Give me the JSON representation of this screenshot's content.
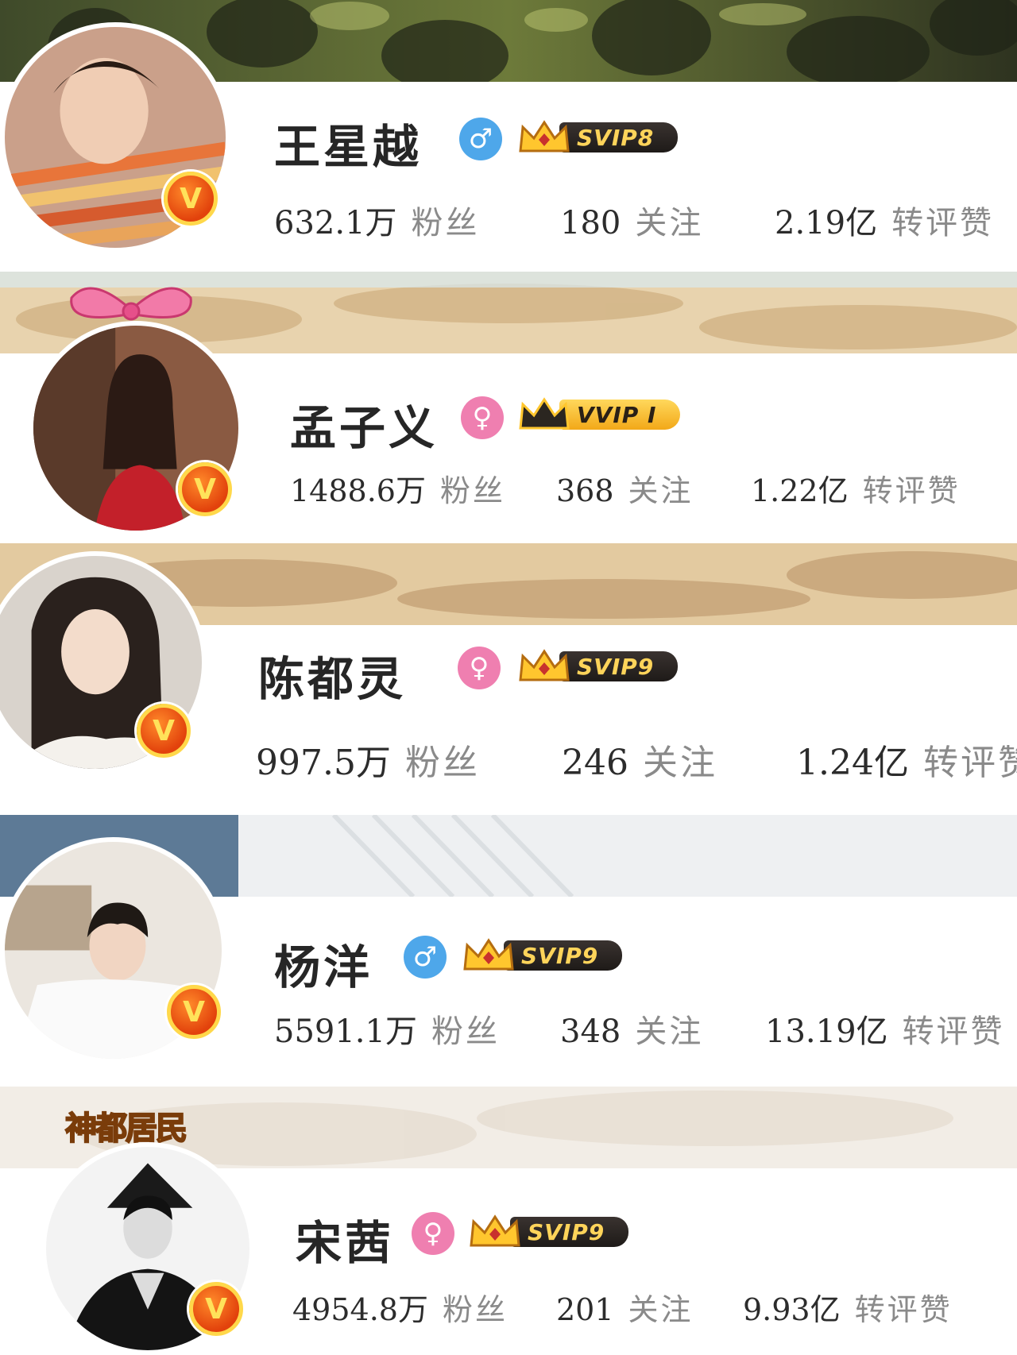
{
  "profiles": [
    {
      "name": "王星越",
      "gender": "male",
      "gender_symbol": "♂",
      "vip_label": "SVIP8",
      "verified": "V",
      "stats": [
        {
          "value": "632.1万",
          "label": "粉丝"
        },
        {
          "value": "180",
          "label": "关注"
        },
        {
          "value": "2.19亿",
          "label": "转评赞"
        }
      ]
    },
    {
      "name": "孟子义",
      "gender": "female",
      "gender_symbol": "♀",
      "vip_label": "VVIP I",
      "verified": "V",
      "stats": [
        {
          "value": "1488.6万",
          "label": "粉丝"
        },
        {
          "value": "368",
          "label": "关注"
        },
        {
          "value": "1.22亿",
          "label": "转评赞"
        }
      ]
    },
    {
      "name": "陈都灵",
      "gender": "female",
      "gender_symbol": "♀",
      "vip_label": "SVIP9",
      "verified": "V",
      "stats": [
        {
          "value": "997.5万",
          "label": "粉丝"
        },
        {
          "value": "246",
          "label": "关注"
        },
        {
          "value": "1.24亿",
          "label": "转评赞"
        }
      ]
    },
    {
      "name": "杨洋",
      "gender": "male",
      "gender_symbol": "♂",
      "vip_label": "SVIP9",
      "verified": "V",
      "stats": [
        {
          "value": "5591.1万",
          "label": "粉丝"
        },
        {
          "value": "348",
          "label": "关注"
        },
        {
          "value": "13.19亿",
          "label": "转评赞"
        }
      ]
    },
    {
      "name": "宋茜",
      "gender": "female",
      "gender_symbol": "♀",
      "vip_label": "SVIP9",
      "verified": "V",
      "avatar_frame_text": "神都居民",
      "stats": [
        {
          "value": "4954.8万",
          "label": "粉丝"
        },
        {
          "value": "201",
          "label": "关注"
        },
        {
          "value": "9.93亿",
          "label": "转评赞"
        }
      ]
    }
  ],
  "colors": {
    "male": "#4ea7ea",
    "female": "#ef7fb0",
    "vip_gold": "#ffd45a",
    "verified_orange": "#e2420c"
  }
}
